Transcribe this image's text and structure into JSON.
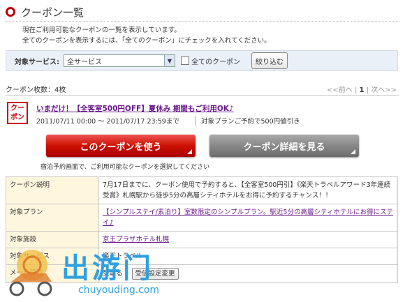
{
  "page": {
    "title": "クーポン一覧",
    "desc_line1": "現在ご利用可能なクーポンの一覧を表示しています。",
    "desc_line2": "全てのクーポンを表示するには、「全てのクーポン」にチェックを入れてください。"
  },
  "filter": {
    "label": "対象サービス:",
    "selected": "全サービス",
    "checkbox_label": "全てのクーポン",
    "button_label": "絞り込む"
  },
  "list": {
    "count_label": "クーポン枚数：4枚",
    "pager_prev": "<<前へ",
    "pager_current": "1",
    "pager_next": "次へ>>"
  },
  "coupon": {
    "badge_line1": "クー",
    "badge_line2": "ポン",
    "title": "いまだけ！【全客室500円OFF】夏休み 期間もご利用OK♪",
    "period": "2011/07/11 00:00 ～ 2011/07/17 23:59まで",
    "note": "対象プランご予約で500円値引き",
    "use_button": "このクーポンを使う",
    "detail_button": "クーポン詳細を見る",
    "button_note": "宿泊予約画面で、ご利用可能なクーポンを選択してください"
  },
  "details": {
    "rows": [
      {
        "key": "クーポン説明",
        "value": "7月17日までに、クーポン使用で予約すると、【全客室500円引】《楽天トラベルアワード3年連続受賞》札幌駅から徒歩5分の高層シティホテルをお得に予約するチャンス！！"
      },
      {
        "key": "対象プラン",
        "value": "【シンプルステイ/素泊り】室数限定のシンプルプラン。駅近5分の高層シティホテルにお得にステイ♪"
      },
      {
        "key": "対象施設",
        "value": "京王プラザホテル札幌"
      },
      {
        "key": "対象サービス",
        "value": "楽天トラベル"
      },
      {
        "key": "メール受取",
        "value": "受取る",
        "button": "受信設定変更"
      }
    ]
  },
  "watermark": {
    "text": "出游门",
    "url": "chuyouding.com"
  }
}
